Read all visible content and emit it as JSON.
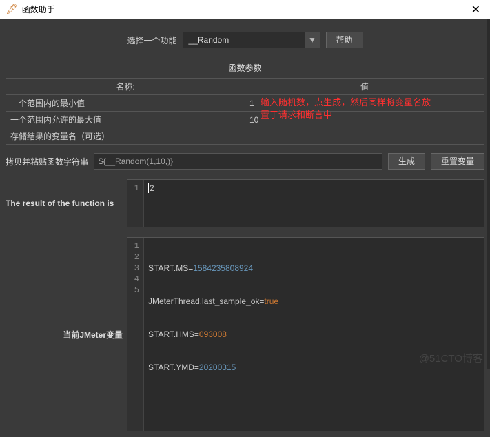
{
  "titlebar": {
    "title": "函数助手"
  },
  "function_row": {
    "label": "选择一个功能",
    "selected": "__Random",
    "help_button": "帮助"
  },
  "param_section_title": "函数参数",
  "param_headers": {
    "name": "名称:",
    "value": "值"
  },
  "params": [
    {
      "name": "一个范围内的最小值",
      "value": "1"
    },
    {
      "name": "一个范围内允许的最大值",
      "value": "10"
    },
    {
      "name": "存储结果的变量名（可选）",
      "value": ""
    }
  ],
  "overlay_hint": "输入随机数，点生成，然后同样将变量名放\n置于请求和断言中",
  "copy_row": {
    "label": "拷贝并粘贴函数字符串",
    "value": "${__Random(1,10,)}",
    "generate": "生成",
    "reset": "重置变量"
  },
  "result_label": "The result of the function is",
  "result_value": "2",
  "vars_label": "当前JMeter变量",
  "vars_lines": [
    {
      "prefix": "START.MS=",
      "num": "1584235808924"
    },
    {
      "prefix": "JMeterThread.last_sample_ok=",
      "bool": "true"
    },
    {
      "prefix": "START.HMS=",
      "orange": "093008"
    },
    {
      "prefix": "START.YMD=",
      "num": "20200315"
    }
  ],
  "watermark": "@51CTO博客"
}
